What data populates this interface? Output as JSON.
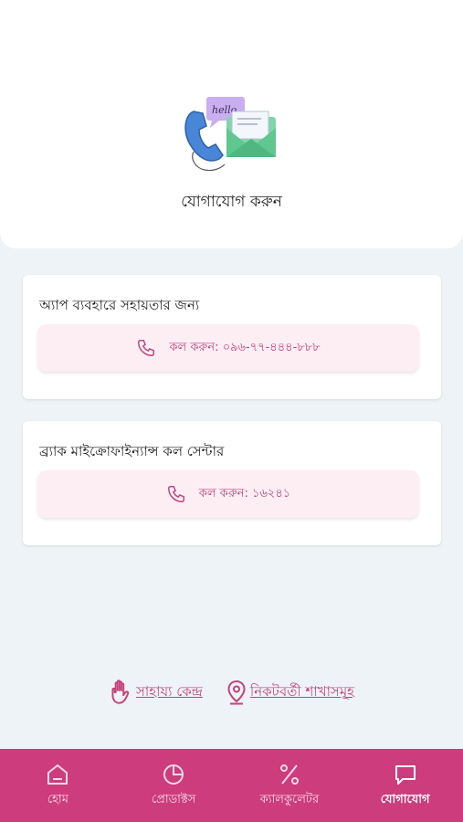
{
  "header": {
    "title": "যোগাযোগ করুন",
    "illustration_text": "hello"
  },
  "cards": [
    {
      "title": "অ্যাপ ব্যবহারে সহায়তার জন্য",
      "call_label": "কল করুন: ০৯৬-৭৭-৪৪৪-৮৮৮"
    },
    {
      "title": "ব্র্যাক মাইক্রোফাইন্যান্স কল সেন্টার",
      "call_label": "কল করুন: ১৬২৪১"
    }
  ],
  "links": {
    "help_center": "সাহায্য কেন্দ্র",
    "nearby_branches": "নিকটবর্তী শাখাসমূহ"
  },
  "nav": {
    "items": [
      {
        "label": "হোম",
        "icon": "home-icon"
      },
      {
        "label": "প্রোডাক্টস",
        "icon": "pie-chart-icon"
      },
      {
        "label": "ক্যালকুলেটর",
        "icon": "percent-icon"
      },
      {
        "label": "যোগাযোগ",
        "icon": "chat-icon"
      }
    ],
    "active": "যোগাযোগ"
  },
  "colors": {
    "brand": "#cd3c7c",
    "accent_text": "#c2437a",
    "button_bg": "#fdeef4",
    "page_bg": "#eef3f7"
  }
}
